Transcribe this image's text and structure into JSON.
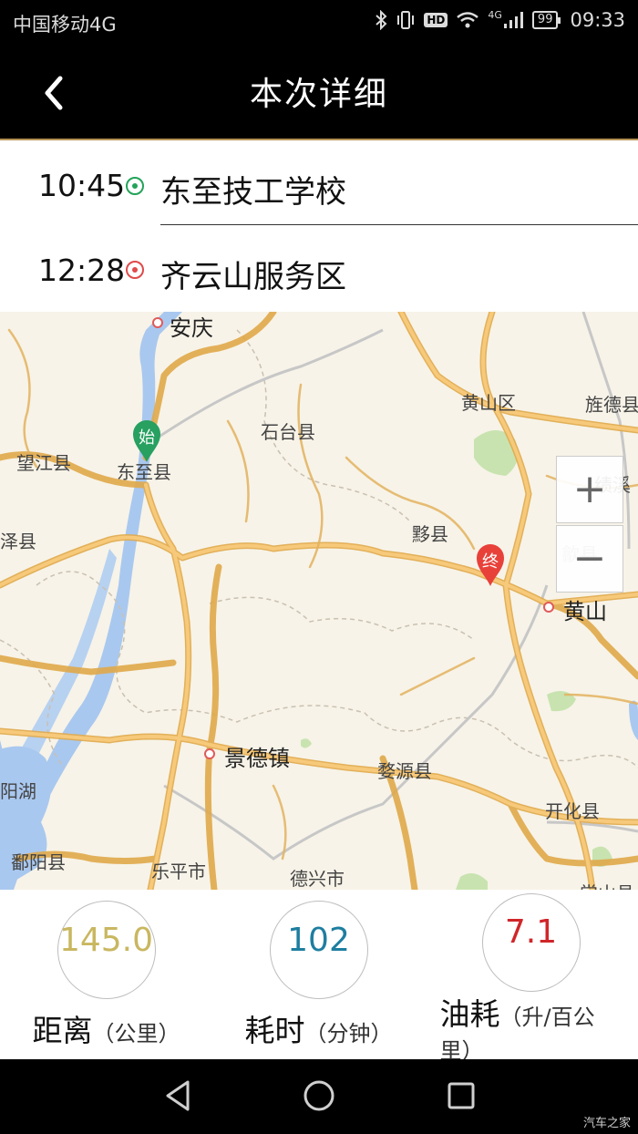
{
  "status_bar": {
    "carrier": "中国移动4G",
    "hd": "HD",
    "network": "4G",
    "battery": "99",
    "time": "09:33"
  },
  "header": {
    "title": "本次详细"
  },
  "route": {
    "start": {
      "time": "10:45",
      "place": "东至技工学校"
    },
    "end": {
      "time": "12:28",
      "place": "齐云山服务区"
    }
  },
  "map": {
    "labels": {
      "anqing": "安庆",
      "huangshanqu": "黄山区",
      "jingdexian": "旌德县",
      "shitaixian": "石台县",
      "wangjiangxian": "望江县",
      "dongzhixian": "东至县",
      "jixi": "绩溪",
      "zexian": "泽县",
      "yixian": "黟县",
      "shexian": "歙县",
      "huangshan": "黄山",
      "jingdezhen": "景德镇",
      "wuyuanxian": "婺源县",
      "kaihuaxian": "开化县",
      "yanghu": "阳湖",
      "poyangxian": "鄱阳县",
      "lepingshi": "乐平市",
      "dexingshi": "德兴市",
      "changshanxian": "常山县"
    },
    "start_pin": "始",
    "end_pin": "终",
    "zoom_in": "+",
    "zoom_out": "−"
  },
  "stats": {
    "distance": {
      "value": "145.0",
      "label": "距离",
      "unit": "（公里）",
      "color": "#c9b760"
    },
    "duration": {
      "value": "102",
      "label": "耗时",
      "unit": "（分钟）",
      "color": "#1e7ea0"
    },
    "fuel": {
      "value": "7.1",
      "label": "油耗",
      "unit": "（升/百公里）",
      "color": "#d0262a"
    }
  },
  "watermark": "汽车之家"
}
